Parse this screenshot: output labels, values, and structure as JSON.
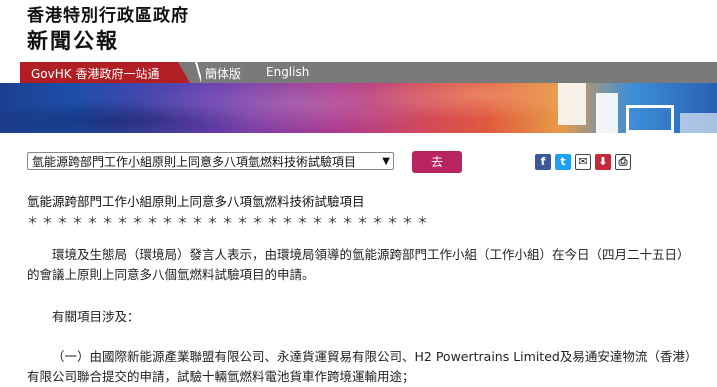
{
  "header": {
    "org_name": "香港特別行政區政府",
    "site_name": "新聞公報"
  },
  "nav": {
    "govhk": "GovHK 香港政府一站通",
    "simplified": "簡体版",
    "english": "English"
  },
  "toolbar": {
    "selected_title": "氫能源跨部門工作小組原則上同意多八項氫燃料技術試驗項目",
    "go_label": "去",
    "share_icons": [
      "facebook-icon",
      "twitter-icon",
      "email-icon",
      "weibo-icon",
      "print-icon"
    ]
  },
  "article": {
    "title": "氫能源跨部門工作小組原則上同意多八項氫燃料技術試驗項目",
    "stars": "＊＊＊＊＊＊＊＊＊＊＊＊＊＊＊＊＊＊＊＊＊＊＊＊＊＊＊",
    "para1": "環境及生態局（環境局）發言人表示，由環境局領導的氫能源跨部門工作小組（工作小組）在今日（四月二十五日）的會議上原則上同意多八個氫燃料試驗項目的申請。",
    "para2": "有關項目涉及：",
    "para3": "（一）由國際新能源產業聯盟有限公司、永達貨運貿易有限公司、H2 Powertrains Limited及易通安達物流（香港）有限公司聯合提交的申請，試驗十輛氫燃料電池貨車作跨境運輸用途；"
  },
  "colors": {
    "nav_red": "#b11f24",
    "nav_grey": "#7a7a7a",
    "go_button": "#b7245f"
  }
}
